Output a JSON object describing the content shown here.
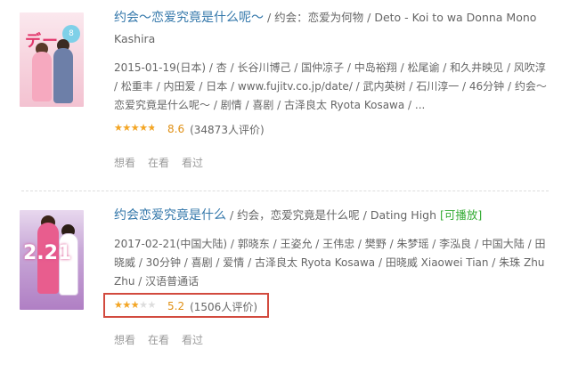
{
  "items": [
    {
      "title": "约会～恋爱究竟是什么呢～",
      "title_rest": " / 约会：恋爱为何物 / Deto - Koi to wa Donna Mono Kashira",
      "playable": "",
      "meta": "2015-01-19(日本) / 杏 / 长谷川博己 / 国仲凉子 / 中岛裕翔 / 松尾谕 / 和久井映见 / 风吹淳 / 松重丰 / 内田爱 / 日本 / www.fujitv.co.jp/date/ / 武内英树 / 石川淳一 / 46分钟 / 约会～恋爱究竟是什么呢～ / 剧情 / 喜剧 / 古泽良太 Ryota Kosawa / ...",
      "rating_fraction": 0.86,
      "score": "8.6",
      "votes": "(34873人评价)",
      "actions": [
        "想看",
        "在看",
        "看过"
      ],
      "poster_text": "デート",
      "poster_badge": "8"
    },
    {
      "title": "约会恋爱究竟是什么",
      "title_rest": " / 约会，恋爱究竟是什么呢 / Dating High ",
      "playable": "[可播放]",
      "meta": "2017-02-21(中国大陆) / 郭晓东 / 王姿允 / 王伟忠 / 樊野 / 朱梦瑶 / 李泓良 / 中国大陆 / 田晓威 / 30分钟 / 喜剧 / 爱情 / 古泽良太 Ryota Kosawa / 田晓威 Xiaowei Tian / 朱珠 Zhu Zhu / 汉语普通话",
      "rating_fraction": 0.52,
      "score": "5.2",
      "votes": "(1506人评价)",
      "actions": [
        "想看",
        "在看",
        "看过"
      ],
      "poster_text": "2.21"
    }
  ],
  "colors": {
    "title_link": "#3377aa",
    "playable": "#33aa33",
    "star": "#f5a623",
    "score": "#e09015",
    "highlight": "#d24a3e"
  },
  "icons": {
    "star": "star-icon"
  }
}
